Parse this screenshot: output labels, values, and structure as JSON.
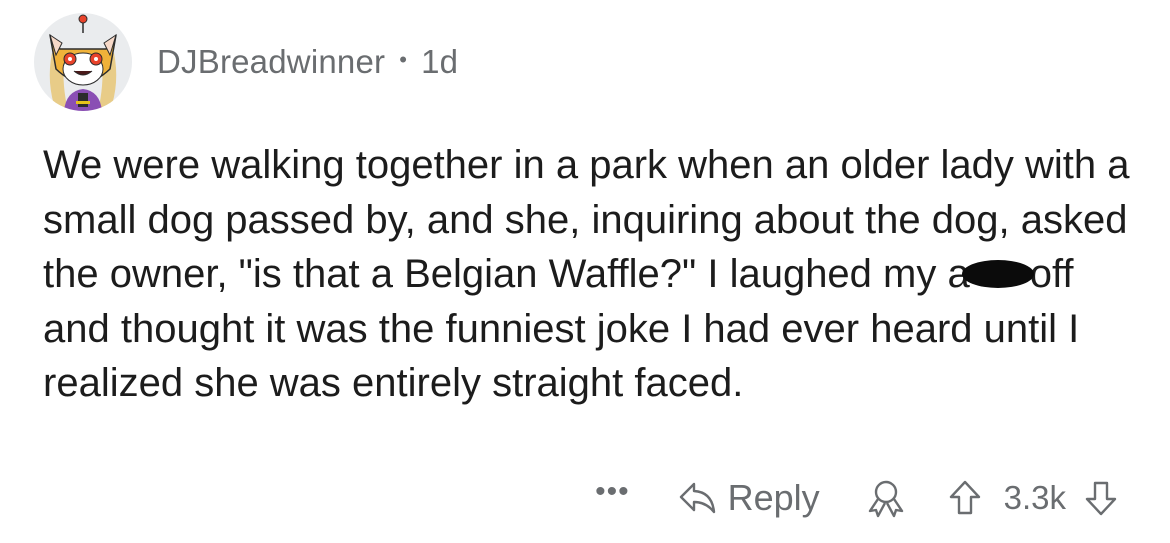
{
  "comment": {
    "author": "DJBreadwinner",
    "separator": "•",
    "age": "1d",
    "text_before_censor": "We were walking together in a park when an older lady with a small dog passed by, and she, inquiring about the dog, asked the owner, \"is that a Belgian Waffle?\" I laughed my a",
    "text_after_censor": "off and thought it was the funniest joke I had ever heard until I realized she was entirely straight faced."
  },
  "actions": {
    "more_label": "•••",
    "reply_label": "Reply",
    "score": "3.3k"
  },
  "colors": {
    "meta_text": "#6a6d70",
    "body_text": "#1c1c1c",
    "avatar_bg": "#eaecee"
  }
}
